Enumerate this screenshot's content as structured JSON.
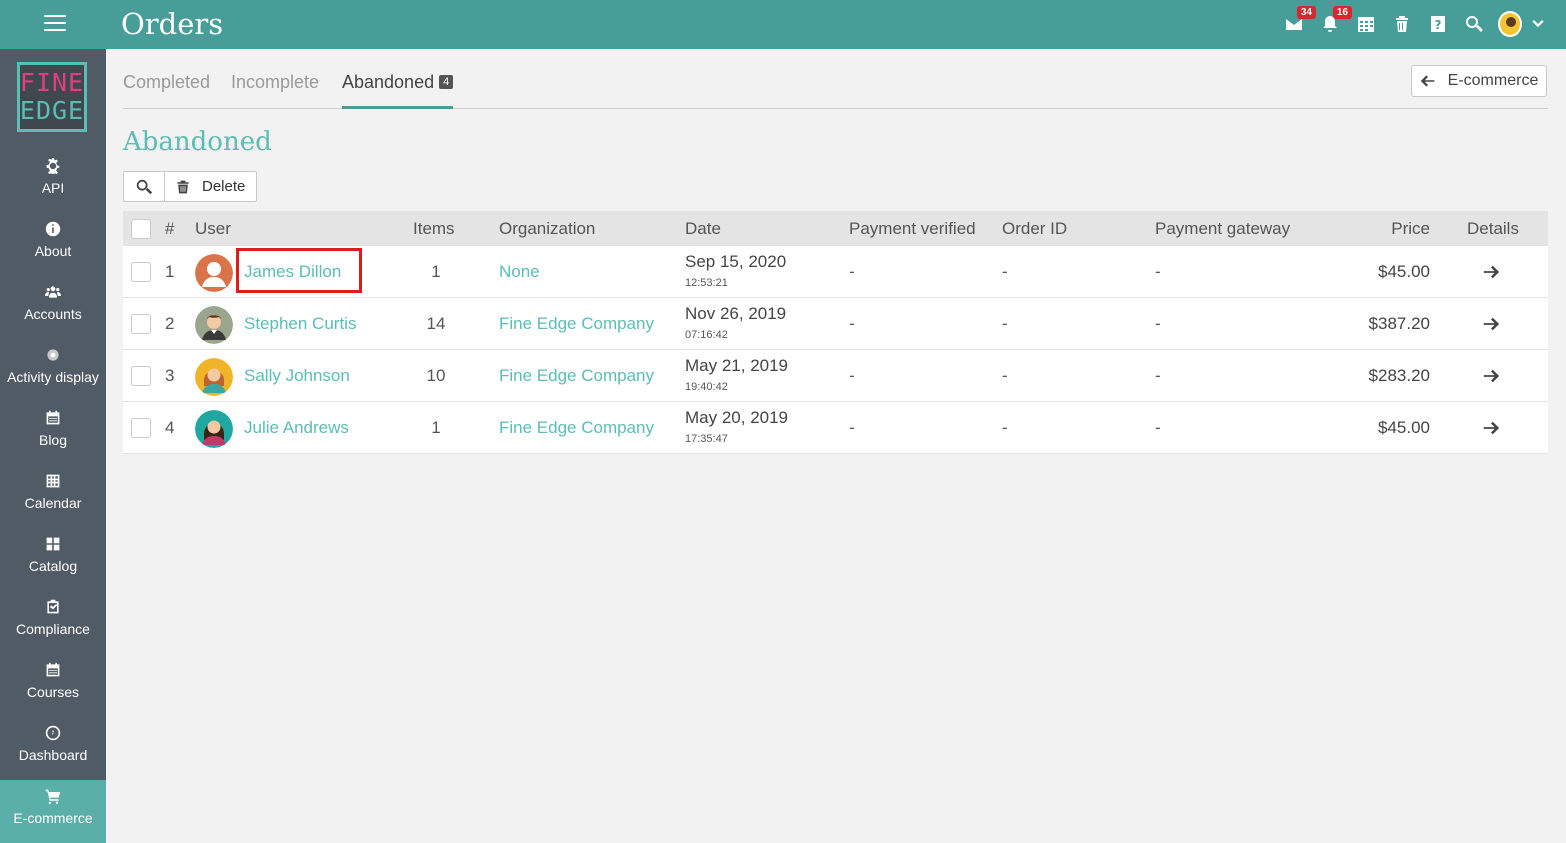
{
  "header": {
    "title": "Orders",
    "notifications": [
      {
        "icon": "mail-icon",
        "count": "34"
      },
      {
        "icon": "bell-icon",
        "count": "16"
      },
      {
        "icon": "calendar-icon",
        "count": ""
      },
      {
        "icon": "trash-icon",
        "count": ""
      },
      {
        "icon": "help-icon",
        "count": ""
      },
      {
        "icon": "search-icon",
        "count": ""
      }
    ]
  },
  "logo": {
    "line1": "FINE",
    "line2": "EDGE"
  },
  "sidebar": {
    "items": [
      {
        "label": "API",
        "icon": "gear-icon"
      },
      {
        "label": "About",
        "icon": "info-icon"
      },
      {
        "label": "Accounts",
        "icon": "users-icon"
      },
      {
        "label": "Activity display",
        "icon": "dot-icon"
      },
      {
        "label": "Blog",
        "icon": "calendar-icon"
      },
      {
        "label": "Calendar",
        "icon": "grid-icon"
      },
      {
        "label": "Catalog",
        "icon": "tiles-icon"
      },
      {
        "label": "Compliance",
        "icon": "check-icon"
      },
      {
        "label": "Courses",
        "icon": "book-icon"
      },
      {
        "label": "Dashboard",
        "icon": "gauge-icon"
      },
      {
        "label": "E-commerce",
        "icon": "cart-icon",
        "active": true
      }
    ]
  },
  "tabs": [
    {
      "label": "Completed"
    },
    {
      "label": "Incomplete"
    },
    {
      "label": "Abandoned",
      "badge": "4",
      "active": true
    }
  ],
  "back_button": {
    "label": "E-commerce"
  },
  "section": {
    "title": "Abandoned"
  },
  "toolbar": {
    "delete_label": "Delete"
  },
  "table": {
    "columns": [
      "#",
      "User",
      "Items",
      "Organization",
      "Date",
      "Payment verified",
      "Order ID",
      "Payment gateway",
      "Price",
      "Details"
    ],
    "rows": [
      {
        "num": "1",
        "user": "James Dillon",
        "items": "1",
        "org": "None",
        "date": "Sep 15, 2020",
        "time": "12:53:21",
        "verified": "-",
        "order_id": "-",
        "gateway": "-",
        "price": "$45.00"
      },
      {
        "num": "2",
        "user": "Stephen Curtis",
        "items": "14",
        "org": "Fine Edge Company",
        "date": "Nov 26, 2019",
        "time": "07:16:42",
        "verified": "-",
        "order_id": "-",
        "gateway": "-",
        "price": "$387.20"
      },
      {
        "num": "3",
        "user": "Sally Johnson",
        "items": "10",
        "org": "Fine Edge Company",
        "date": "May 21, 2019",
        "time": "19:40:42",
        "verified": "-",
        "order_id": "-",
        "gateway": "-",
        "price": "$283.20"
      },
      {
        "num": "4",
        "user": "Julie Andrews",
        "items": "1",
        "org": "Fine Edge Company",
        "date": "May 20, 2019",
        "time": "17:35:47",
        "verified": "-",
        "order_id": "-",
        "gateway": "-",
        "price": "$45.00"
      }
    ]
  },
  "colors": {
    "accent": "#479d98",
    "link": "#5bbdb4",
    "sidebar": "#515b65",
    "highlight": "#e01b1b"
  }
}
